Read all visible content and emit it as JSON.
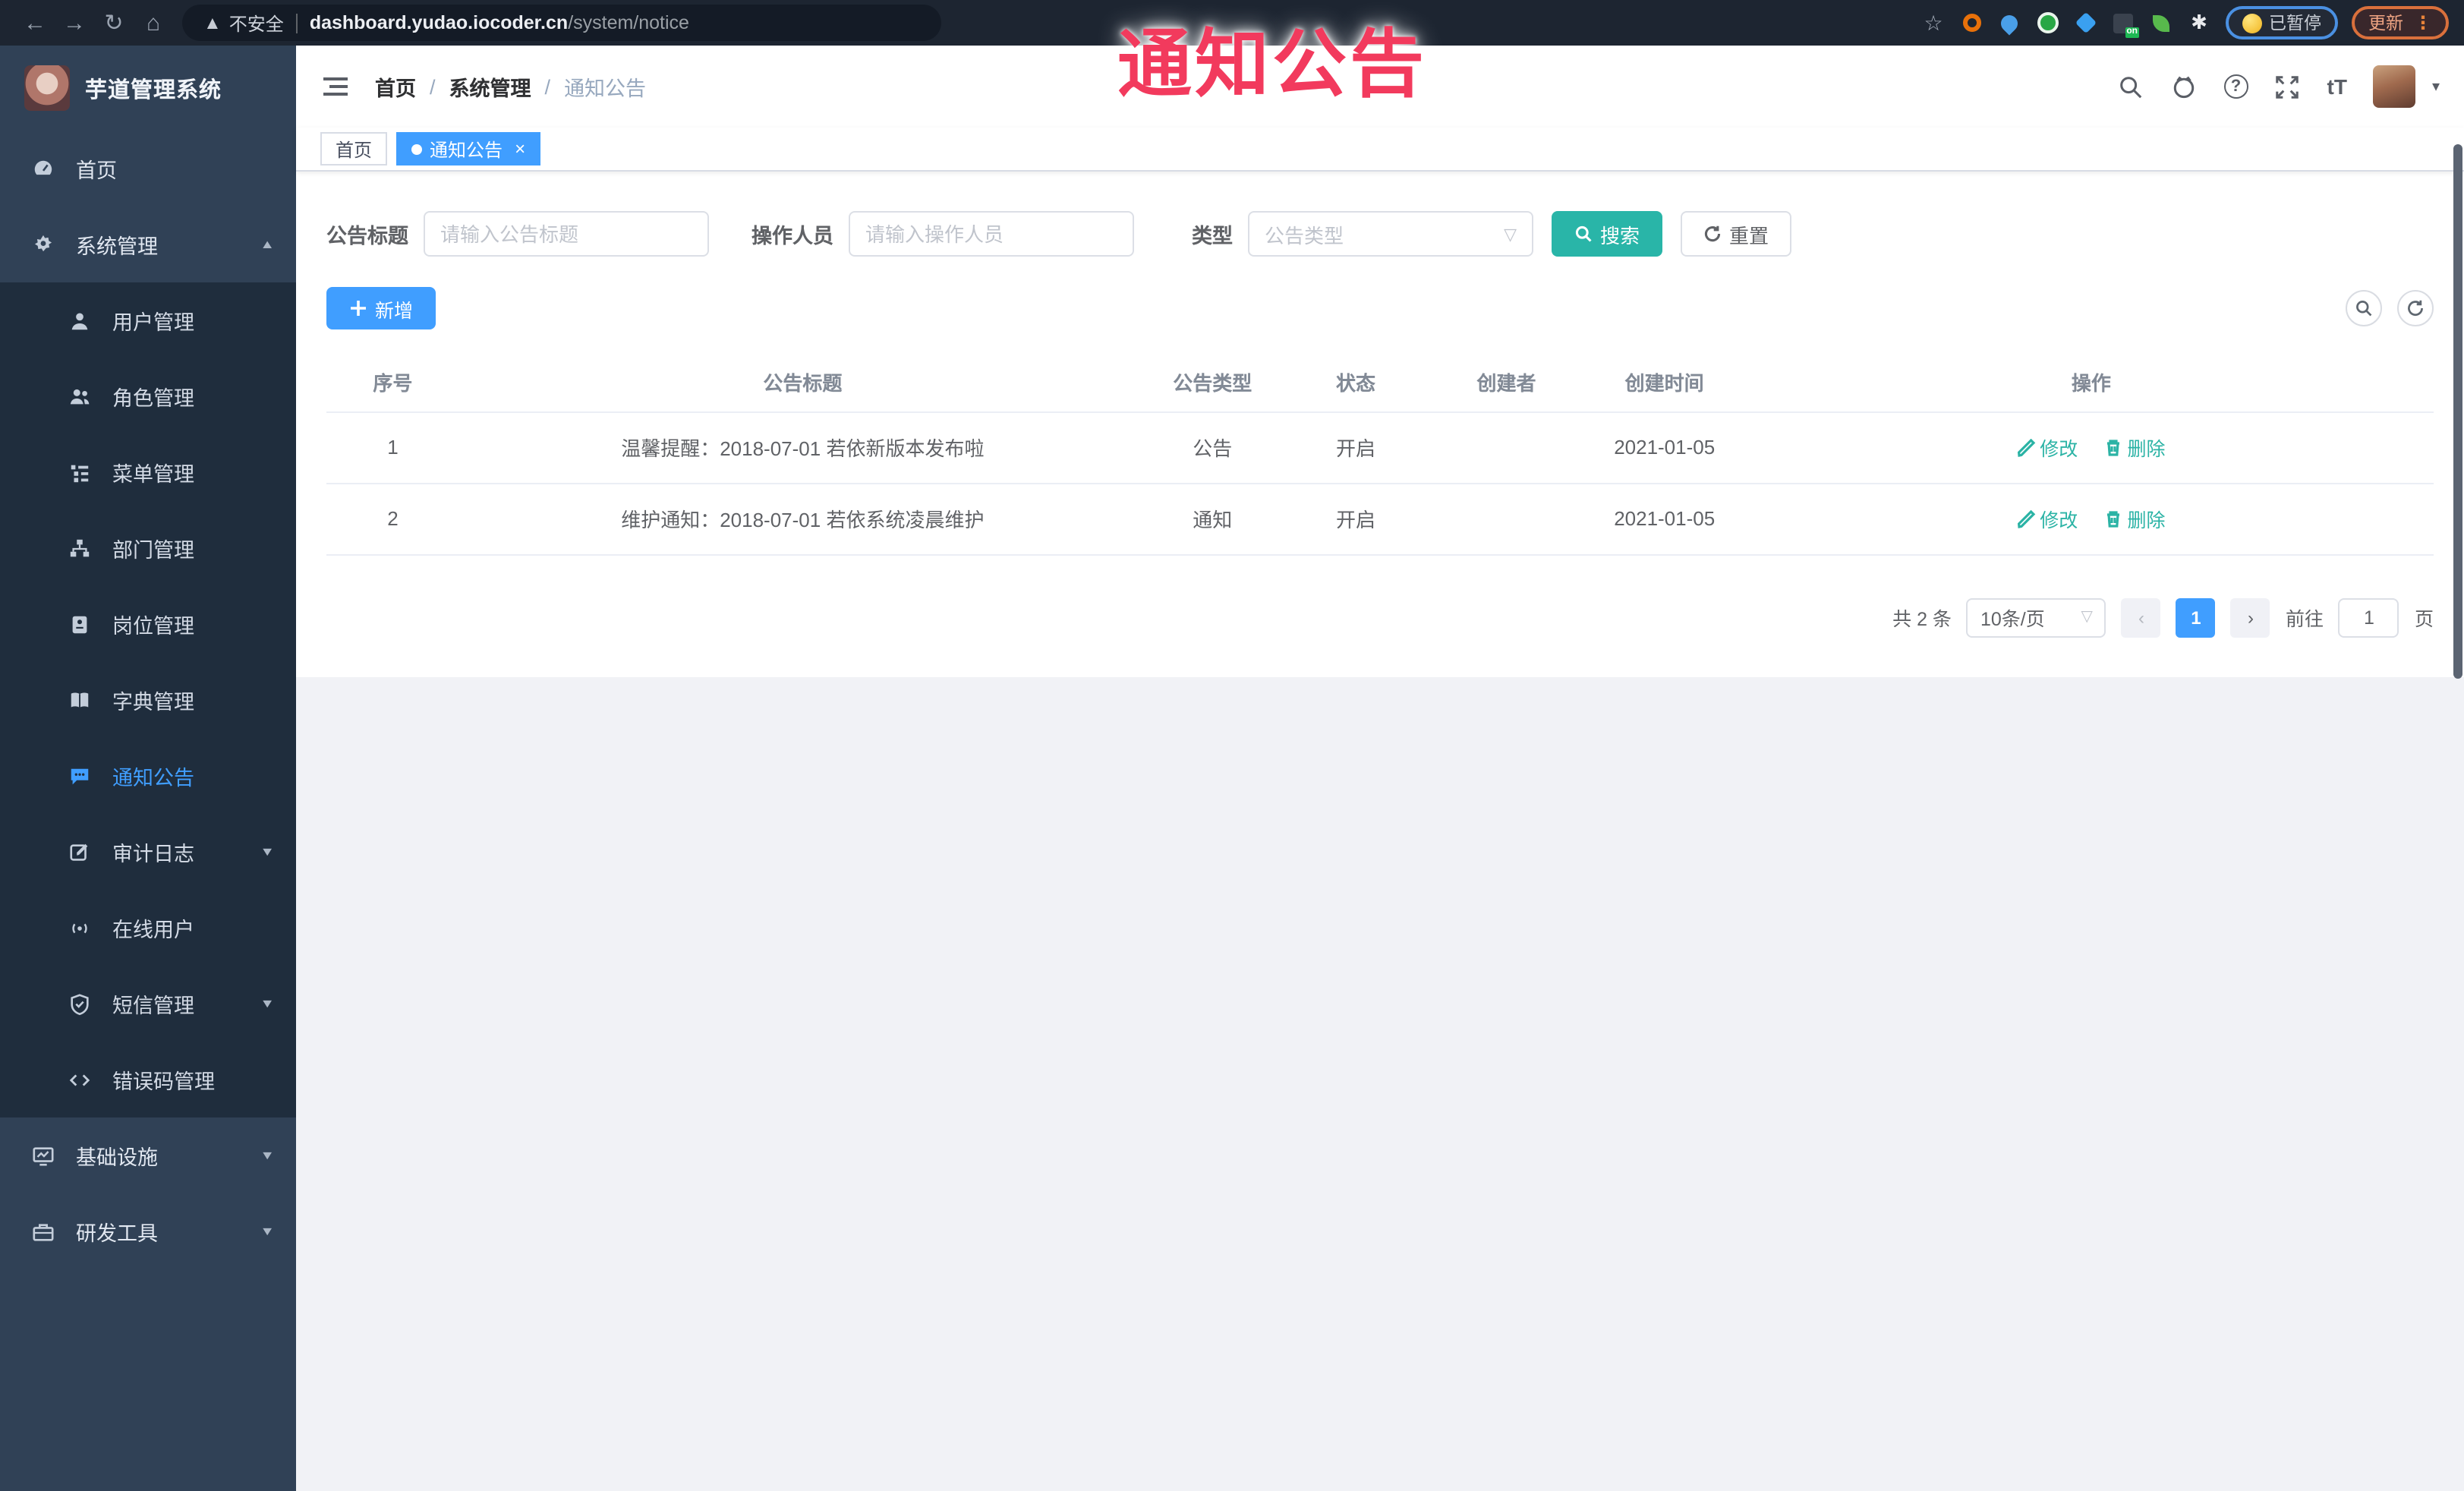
{
  "browser": {
    "insecure_label": "不安全",
    "url_host": "dashboard.yudao.iocoder.cn",
    "url_path": "/system/notice",
    "paused_chip": "已暂停",
    "update_button": "更新",
    "on_badge": "on"
  },
  "watermark": {
    "text": "通知公告",
    "color": "#f23a5d"
  },
  "sidebar": {
    "title": "芋道管理系统",
    "items": [
      {
        "label": "首页"
      },
      {
        "label": "系统管理"
      },
      {
        "label": "基础设施"
      },
      {
        "label": "研发工具"
      }
    ],
    "system_children": [
      {
        "label": "用户管理"
      },
      {
        "label": "角色管理"
      },
      {
        "label": "菜单管理"
      },
      {
        "label": "部门管理"
      },
      {
        "label": "岗位管理"
      },
      {
        "label": "字典管理"
      },
      {
        "label": "通知公告"
      },
      {
        "label": "审计日志"
      },
      {
        "label": "在线用户"
      },
      {
        "label": "短信管理"
      },
      {
        "label": "错误码管理"
      }
    ],
    "active_item": "通知公告",
    "active_color": "#409eff"
  },
  "header": {
    "breadcrumb": [
      "首页",
      "系统管理",
      "通知公告"
    ],
    "separator": "/"
  },
  "tags": [
    {
      "label": "首页",
      "active": false
    },
    {
      "label": "通知公告",
      "active": true
    }
  ],
  "filters": {
    "title_label": "公告标题",
    "title_placeholder": "请输入公告标题",
    "operator_label": "操作人员",
    "operator_placeholder": "请输入操作人员",
    "type_label": "类型",
    "type_placeholder": "公告类型",
    "search_label": "搜索",
    "reset_label": "重置"
  },
  "toolbar": {
    "add_label": "新增"
  },
  "table": {
    "columns": [
      "序号",
      "公告标题",
      "公告类型",
      "状态",
      "创建者",
      "创建时间",
      "操作"
    ],
    "rows": [
      {
        "index": "1",
        "title": "温馨提醒：2018-07-01 若依新版本发布啦",
        "type": "公告",
        "status": "开启",
        "creator": "",
        "created": "2021-01-05",
        "edit": "修改",
        "delete": "删除"
      },
      {
        "index": "2",
        "title": "维护通知：2018-07-01 若依系统凌晨维护",
        "type": "通知",
        "status": "开启",
        "creator": "",
        "created": "2021-01-05",
        "edit": "修改",
        "delete": "删除"
      }
    ]
  },
  "pagination": {
    "total": "共 2 条",
    "page_size": "10条/页",
    "current": "1",
    "goto_label": "前往",
    "goto_value": "1",
    "page_label": "页"
  },
  "colors": {
    "accent": "#409eff",
    "teal": "#29b5a8",
    "sidebar_bg": "#304156",
    "submenu_bg": "#1f2d3d",
    "chrome_bg": "#1d2531"
  }
}
